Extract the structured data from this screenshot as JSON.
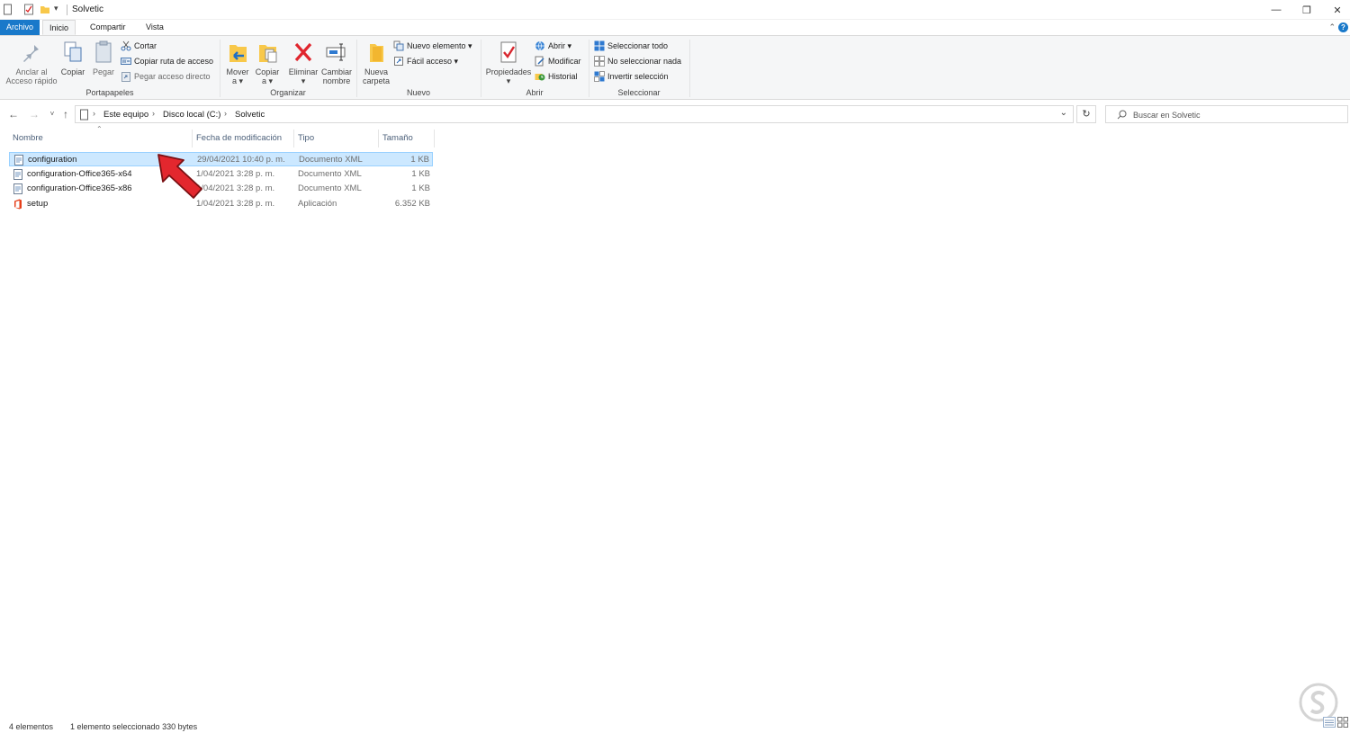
{
  "window": {
    "title": "Solvetic",
    "controls": {
      "minimize": "—",
      "restore": "❐",
      "close": "✕"
    }
  },
  "ribbon_tabs": [
    {
      "label": "Archivo"
    },
    {
      "label": "Inicio"
    },
    {
      "label": "Compartir"
    },
    {
      "label": "Vista"
    }
  ],
  "ribbon": {
    "clipboard": {
      "pin_line1": "Anclar al",
      "pin_line2": "Acceso rápido",
      "copy": "Copiar",
      "paste": "Pegar",
      "cut": "Cortar",
      "copy_path": "Copiar ruta de acceso",
      "paste_shortcut": "Pegar acceso directo",
      "group_label": "Portapapeles"
    },
    "organize": {
      "move_line1": "Mover",
      "move_line2": "a ▾",
      "copy_to_line1": "Copiar",
      "copy_to_line2": "a ▾",
      "delete_line1": "Eliminar",
      "delete_line2": "▾",
      "rename_line1": "Cambiar",
      "rename_line2": "nombre",
      "group_label": "Organizar"
    },
    "new": {
      "new_folder_line1": "Nueva",
      "new_folder_line2": "carpeta",
      "new_item": "Nuevo elemento ▾",
      "easy_access": "Fácil acceso ▾",
      "group_label": "Nuevo"
    },
    "open": {
      "properties_line1": "Propiedades",
      "properties_line2": "▾",
      "open": "Abrir ▾",
      "edit": "Modificar",
      "history": "Historial",
      "group_label": "Abrir"
    },
    "select": {
      "select_all": "Seleccionar todo",
      "select_none": "No seleccionar nada",
      "invert": "Invertir selección",
      "group_label": "Seleccionar"
    }
  },
  "address": {
    "crumbs": [
      "Este equipo",
      "Disco local (C:)",
      "Solvetic"
    ],
    "search_placeholder": "Buscar en Solvetic"
  },
  "columns": [
    "Nombre",
    "Fecha de modificación",
    "Tipo",
    "Tamaño"
  ],
  "files": [
    {
      "name": "configuration",
      "date": "29/04/2021 10:40 p. m.",
      "type": "Documento XML",
      "size": "1 KB",
      "selected": true,
      "icon": "xml-file-icon"
    },
    {
      "name": "configuration-Office365-x64",
      "date": "1/04/2021 3:28 p. m.",
      "type": "Documento XML",
      "size": "1 KB",
      "selected": false,
      "icon": "xml-file-icon"
    },
    {
      "name": "configuration-Office365-x86",
      "date": "1/04/2021 3:28 p. m.",
      "type": "Documento XML",
      "size": "1 KB",
      "selected": false,
      "icon": "xml-file-icon"
    },
    {
      "name": "setup",
      "date": "1/04/2021 3:28 p. m.",
      "type": "Aplicación",
      "size": "6.352 KB",
      "selected": false,
      "icon": "office-app-icon"
    }
  ],
  "status": {
    "count": "4 elementos",
    "selection": "1 elemento seleccionado  330 bytes"
  },
  "colors": {
    "accent": "#1979ca",
    "selection_bg": "#cce8ff",
    "selection_border": "#99d1ff",
    "arrow": "#e3272e"
  }
}
